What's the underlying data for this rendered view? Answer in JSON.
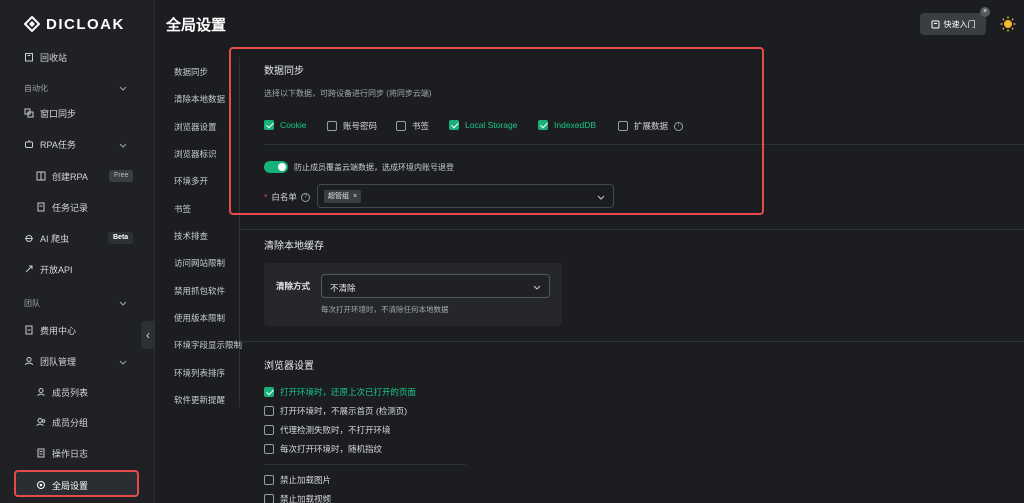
{
  "app": {
    "logo_text": "DICLOAK"
  },
  "header": {
    "title": "全局设置",
    "quick_start": "快速入门",
    "close_glyph": "×"
  },
  "sidebar": {
    "recycle": "回收站",
    "group_automation": "自动化",
    "window_sync": "窗口同步",
    "rpa_tasks": "RPA任务",
    "create_rpa": "创建RPA",
    "free_badge": "Free",
    "task_records": "任务记录",
    "ai_crawler": "AI 爬虫",
    "beta_badge": "Beta",
    "open_api": "开放API",
    "group_team": "团队",
    "billing": "费用中心",
    "team_mgmt": "团队管理",
    "member_list": "成员列表",
    "member_groups": "成员分组",
    "operation_log": "操作日志",
    "global_settings": "全局设置"
  },
  "nav": [
    "数据同步",
    "清除本地数据",
    "浏览器设置",
    "浏览器标识",
    "环境多开",
    "书签",
    "技术排查",
    "访问网站限制",
    "禁用抓包软件",
    "使用版本限制",
    "环境字段显示限制",
    "环境列表排序",
    "软件更新提醒"
  ],
  "data_sync": {
    "title": "数据同步",
    "desc": "选择以下数据，可跨设备进行同步 (将同步云端)",
    "options": [
      {
        "label": "Cookie",
        "checked": true
      },
      {
        "label": "账号密码",
        "checked": false
      },
      {
        "label": "书签",
        "checked": false
      },
      {
        "label": "Local Storage",
        "checked": true
      },
      {
        "label": "IndexedDB",
        "checked": true
      },
      {
        "label": "扩展数据",
        "checked": false
      }
    ],
    "toggle_label": "防止成员覆盖云端数据，选成环境内账号退登",
    "whitelist_label": "白名单",
    "whitelist_tag": "超管组",
    "required_mark": "*",
    "info_glyph": "!",
    "help_glyph": "?",
    "tag_close": "×"
  },
  "clear_cache": {
    "title": "清除本地缓存",
    "label": "清除方式",
    "value": "不清除",
    "hint": "每次打开环境时，不清除任何本地数据"
  },
  "browser": {
    "title": "浏览器设置",
    "options": [
      {
        "label": "打开环境时，还原上次已打开的页面",
        "checked": true
      },
      {
        "label": "打开环境时，不展示首页 (检测页)",
        "checked": false
      },
      {
        "label": "代理检测失败时，不打开环境",
        "checked": false
      },
      {
        "label": "每次打开环境时，随机指纹",
        "checked": false
      },
      {
        "label": "禁止加载图片",
        "checked": false
      },
      {
        "label": "禁止加载视频",
        "checked": false
      }
    ]
  },
  "colors": {
    "accent": "#19b07a",
    "highlight": "#e84a4a"
  }
}
